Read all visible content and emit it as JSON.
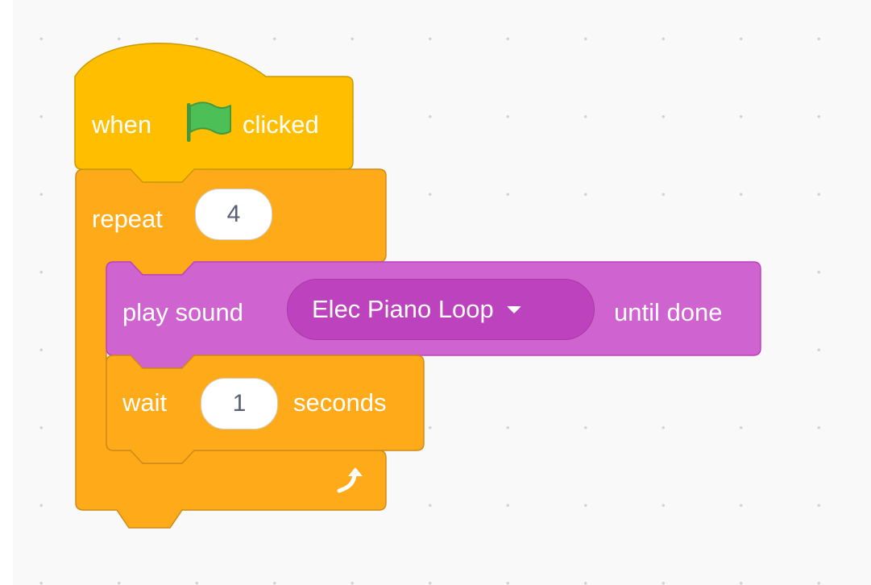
{
  "workspace": {
    "hat_block": {
      "prefix": "when",
      "icon": "green-flag-icon",
      "suffix": "clicked",
      "color": "#ffbf00"
    },
    "repeat_block": {
      "label": "repeat",
      "count": "4",
      "loop_icon": "loop-arrow-icon",
      "color": "#ffab19"
    },
    "sound_block": {
      "prefix": "play sound",
      "sound_name": "Elec Piano Loop",
      "suffix": "until done",
      "color": "#cf63cf"
    },
    "wait_block": {
      "prefix": "wait",
      "value": "1",
      "suffix": "seconds",
      "color": "#ffab19"
    }
  }
}
